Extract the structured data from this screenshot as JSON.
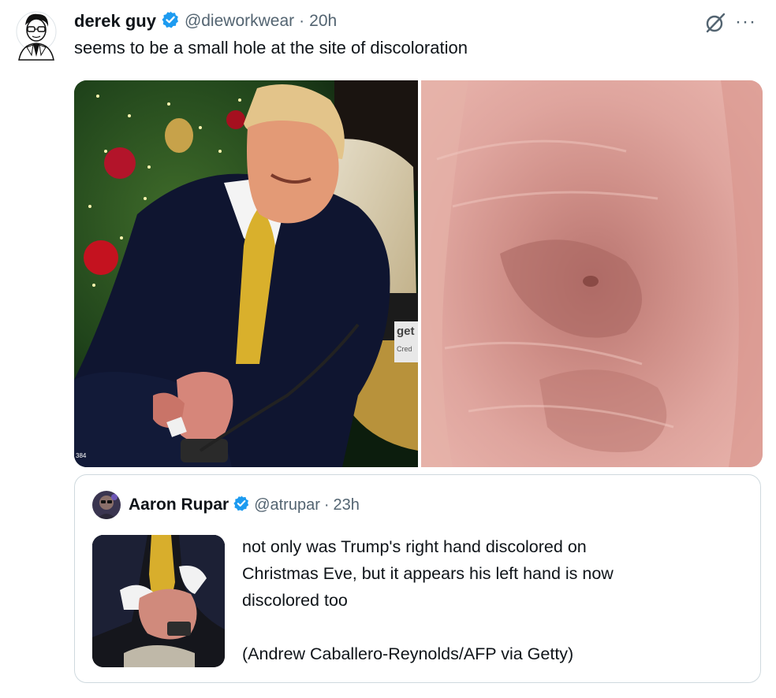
{
  "tweet": {
    "author_name": "derek guy",
    "author_handle": "@dieworkwear",
    "separator": "·",
    "time": "20h",
    "text": "seems to be a small hole at the site of discoloration",
    "more_label": "···"
  },
  "media": {
    "left_photo_watermark": "get",
    "left_photo_watermark_sub": "Cred",
    "left_photo_code": "384"
  },
  "quoted": {
    "author_name": "Aaron Rupar",
    "author_handle": "@atrupar",
    "separator": "·",
    "time": "23h",
    "text_lines": [
      "not only was Trump's right hand discolored on",
      "Christmas Eve, but it appears his left hand is now",
      "discolored too"
    ],
    "credit": "(Andrew Caballero-Reynolds/AFP via Getty)"
  },
  "colors": {
    "verified": "#1d9bf0",
    "secondary_text": "#536471",
    "border": "#cfd9de"
  },
  "icons": [
    "avatar-illustration",
    "verified-badge-icon",
    "grok-icon",
    "more-icon"
  ]
}
